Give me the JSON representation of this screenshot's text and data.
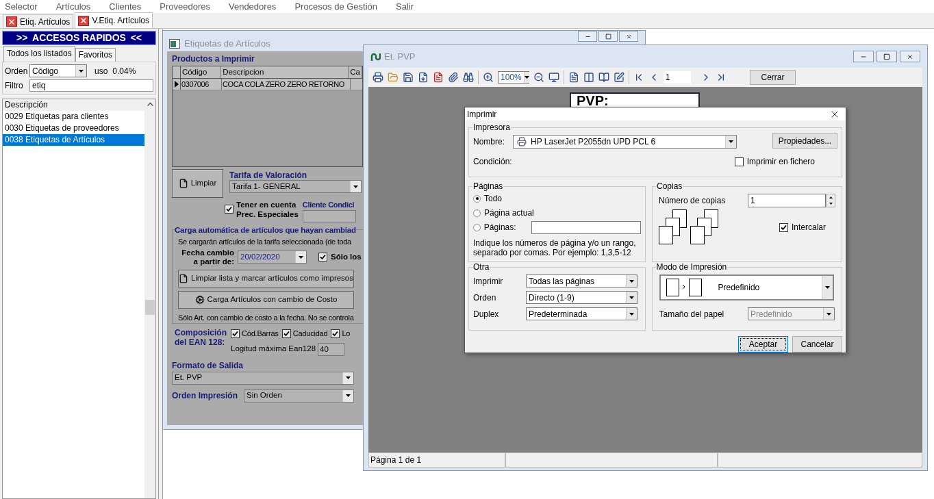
{
  "menu": [
    "Selector",
    "Artículos",
    "Clientes",
    "Proveedores",
    "Vendedores",
    "Procesos de Gestión",
    "Salir"
  ],
  "doc_tabs": [
    {
      "label": "Etiq. Artículos",
      "selected": false
    },
    {
      "label": "V.Etiq. Artículos",
      "selected": true
    }
  ],
  "sidebar": {
    "title_left": ">>",
    "title": "ACCESOS RAPIDOS",
    "title_right": "<<",
    "tabs": [
      {
        "label": "Todos los listados",
        "selected": true
      },
      {
        "label": "Favoritos",
        "selected": false
      }
    ],
    "order_label": "Orden",
    "order_value": "Código",
    "uso_label": "uso",
    "uso_value": "0.04%",
    "filter_label": "Filtro",
    "filter_value": "etiq",
    "list_header": "Descripción",
    "items": [
      {
        "label": "0029 Etiquetas para clientes",
        "selected": false
      },
      {
        "label": "0030 Etiquetas de proveedores",
        "selected": false
      },
      {
        "label": "0038 Etiquetas de Artículos",
        "selected": true
      }
    ]
  },
  "labels_window": {
    "title": "Etiquetas de Artículos",
    "products_label": "Productos a Imprimir",
    "columns": [
      "Código",
      "Descripcion",
      "Ca"
    ],
    "rows": [
      {
        "cells": [
          "0307006",
          "COCA COLA ZERO ZERO RETORNO"
        ],
        "current": true
      }
    ],
    "clear_button": "Limpiar",
    "rate_label": "Tarifa de Valoración",
    "rate_value": "Tarifa 1- GENERAL",
    "special_prices": {
      "lines": [
        "Tener en cuenta",
        "Prec. Especiales"
      ],
      "checked": true
    },
    "client_label": "Cliente Condici",
    "auto_group": {
      "title": "Carga automática de artículos que hayan cambiad",
      "note": "Se cargarán artículos de la tarifa seleccionada (de toda",
      "date_lines": [
        "Fecha cambio",
        "a partir de:"
      ],
      "date_value": "20/02/2020",
      "only": {
        "label": "Sólo los",
        "checked": true
      },
      "buttons": [
        "Limpiar lista y marcar artículos como impresos",
        "Carga Artículos con cambio de Costo"
      ],
      "footnote": "Sólo Art. con cambio de costo a la fecha. No se controla"
    },
    "ean": {
      "lines": [
        "Composición",
        "del EAN 128:"
      ],
      "options": [
        {
          "label": "Cód.Barras",
          "checked": true
        },
        {
          "label": "Caducidad",
          "checked": true
        },
        {
          "label": "Lo",
          "checked": true
        }
      ],
      "max_label": "Logitud máxima Ean128",
      "max_value": "40"
    },
    "format_label": "Formato de Salida",
    "format_value": "Et. PVP",
    "order_label": "Orden Impresión",
    "order_value": "Sin Orden"
  },
  "preview_window": {
    "title": "Et. PVP",
    "zoom": "100%",
    "page": "1",
    "close_button": "Cerrar",
    "page_text": "PVP:",
    "status": "Página 1 de 1"
  },
  "print_dialog": {
    "title": "Imprimir",
    "printer_group": "Impresora",
    "name_label": "Nombre:",
    "printer": "HP LaserJet P2055dn UPD PCL 6",
    "properties_button": "Propiedades...",
    "status_label": "Condición:",
    "to_file": {
      "label": "Imprimir en fichero",
      "checked": false
    },
    "pages_group": "Páginas",
    "ranges": [
      {
        "label": "Todo",
        "selected": true
      },
      {
        "label": "Página actual",
        "selected": false
      },
      {
        "label": "Páginas:",
        "selected": false
      }
    ],
    "pages_note": [
      "Indique los números de página y/o un rango,",
      "separado por comas. Por ejemplo: 1,3,5-12"
    ],
    "copies_group": "Copias",
    "copies_label": "Número de copias",
    "copies_value": "1",
    "collate": {
      "label": "Intercalar",
      "checked": true
    },
    "other_group": "Otra",
    "other_rows": [
      {
        "label": "Imprimir",
        "value": "Todas las páginas"
      },
      {
        "label": "Orden",
        "value": "Directo (1-9)"
      },
      {
        "label": "Duplex",
        "value": "Predeterminada"
      }
    ],
    "mode_group": "Modo de Impresión",
    "mode_value": "Predefinido",
    "paper_label": "Tamaño del papel",
    "paper_value": "Predefinido",
    "paper_disabled": true,
    "buttons": [
      {
        "label": "Aceptar",
        "default": true
      },
      {
        "label": "Cancelar",
        "default": false
      }
    ]
  }
}
